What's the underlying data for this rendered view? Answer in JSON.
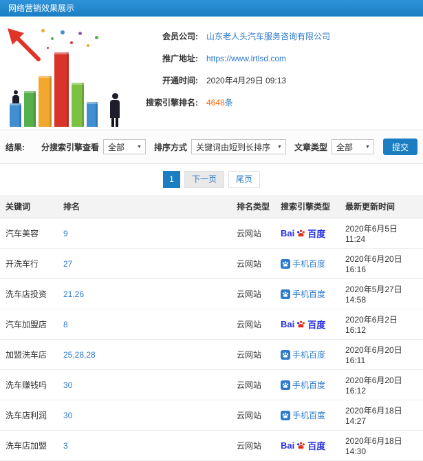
{
  "header": {
    "title": "网络营销效果展示"
  },
  "info": {
    "company": {
      "label": "会员公司:",
      "value": "山东老人头汽车服务咨询有限公司"
    },
    "site": {
      "label": "推广地址:",
      "value": "https://www.lrtlsd.com"
    },
    "opened": {
      "label": "开通时间:",
      "value": "2020年4月29日 09:13"
    },
    "rank_count": {
      "label": "搜索引擎排名:",
      "number": "4648",
      "unit": "条"
    }
  },
  "filters": {
    "result_label": "结果:",
    "engine_label": "分搜索引擎查看",
    "engine_value": "全部",
    "sort_label": "排序方式",
    "sort_value": "关键词由短到长排序",
    "article_label": "文章类型",
    "article_value": "全部",
    "submit_label": "提交"
  },
  "pagination": {
    "current": "1",
    "next": "下一页",
    "last": "尾页"
  },
  "table": {
    "headers": [
      "关键词",
      "排名",
      "排名类型",
      "搜索引擎类型",
      "最新更新时间"
    ],
    "rows": [
      {
        "keyword": "汽车美容",
        "rank": "9",
        "rank_type": "云网站",
        "engine": "baidu",
        "engine_prefix": "Bai",
        "engine_label": "百度",
        "updated": "2020年6月5日 11:24"
      },
      {
        "keyword": "开洗车行",
        "rank": "27",
        "rank_type": "云网站",
        "engine": "mobile-baidu",
        "engine_label": "手机百度",
        "updated": "2020年6月20日 16:16"
      },
      {
        "keyword": "洗车店投资",
        "rank": "21,26",
        "rank_type": "云网站",
        "engine": "mobile-baidu",
        "engine_label": "手机百度",
        "updated": "2020年5月27日 14:58"
      },
      {
        "keyword": "汽车加盟店",
        "rank": "8",
        "rank_type": "云网站",
        "engine": "baidu",
        "engine_prefix": "Bai",
        "engine_label": "百度",
        "updated": "2020年6月2日 16:12"
      },
      {
        "keyword": "加盟洗车店",
        "rank": "25,28,28",
        "rank_type": "云网站",
        "engine": "mobile-baidu",
        "engine_label": "手机百度",
        "updated": "2020年6月20日 16:11"
      },
      {
        "keyword": "洗车赚钱吗",
        "rank": "30",
        "rank_type": "云网站",
        "engine": "mobile-baidu",
        "engine_label": "手机百度",
        "updated": "2020年6月20日 16:12"
      },
      {
        "keyword": "洗车店利润",
        "rank": "30",
        "rank_type": "云网站",
        "engine": "mobile-baidu",
        "engine_label": "手机百度",
        "updated": "2020年6月18日 14:27"
      },
      {
        "keyword": "洗车店加盟",
        "rank": "3",
        "rank_type": "云网站",
        "engine": "baidu",
        "engine_prefix": "Bai",
        "engine_label": "百度",
        "updated": "2020年6月18日 14:30"
      }
    ]
  },
  "icons": {
    "caret_down": "▼"
  },
  "colors": {
    "primary_blue": "#1b7ec2",
    "link_blue": "#2e7bcc",
    "highlight_orange": "#ff6600",
    "baidu_blue": "#2932e1",
    "baidu_red": "#e10601"
  }
}
